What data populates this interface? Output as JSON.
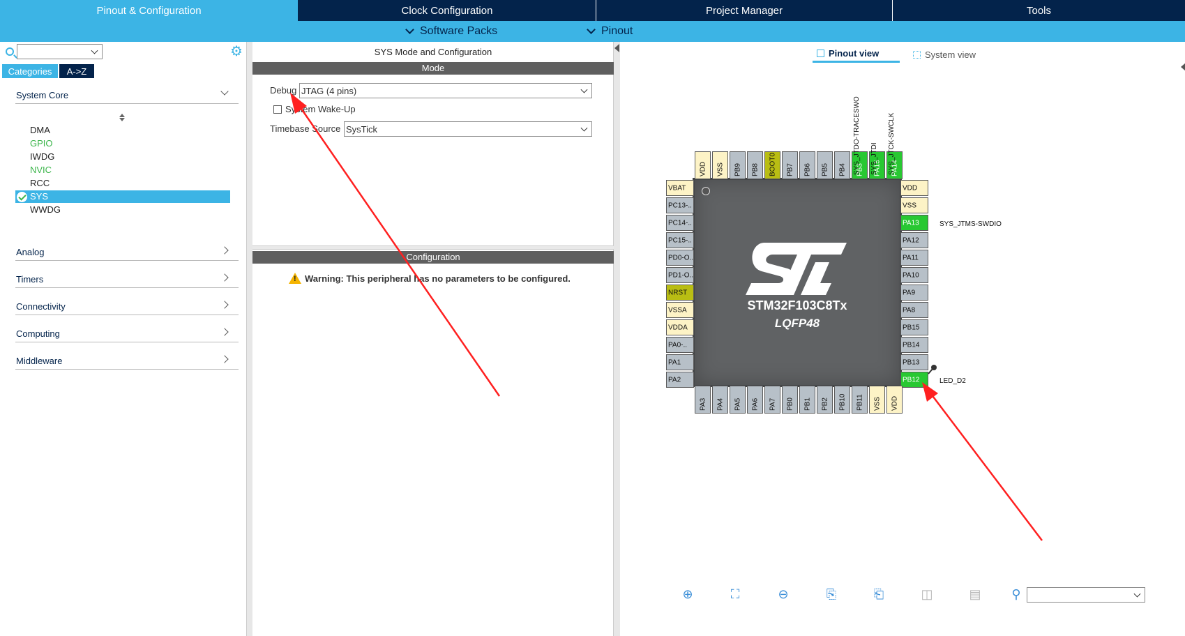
{
  "top_tabs": {
    "pinout": "Pinout & Configuration",
    "clock": "Clock Configuration",
    "project": "Project Manager",
    "tools": "Tools"
  },
  "subbar": {
    "software_packs": "Software Packs",
    "pinout": "Pinout"
  },
  "left": {
    "tabs": {
      "categories": "Categories",
      "az": "A->Z"
    },
    "sections": {
      "system_core": "System Core",
      "analog": "Analog",
      "timers": "Timers",
      "connectivity": "Connectivity",
      "computing": "Computing",
      "middleware": "Middleware"
    },
    "items": {
      "dma": "DMA",
      "gpio": "GPIO",
      "iwdg": "IWDG",
      "nvic": "NVIC",
      "rcc": "RCC",
      "sys": "SYS",
      "wwdg": "WWDG"
    }
  },
  "middle": {
    "title": "SYS Mode and Configuration",
    "mode_header": "Mode",
    "debug_label": "Debug",
    "debug_value": "JTAG (4 pins)",
    "wakeup_label": "System Wake-Up",
    "timebase_label": "Timebase Source",
    "timebase_value": "SysTick",
    "config_header": "Configuration",
    "warning": "Warning: This peripheral has no parameters to be configured."
  },
  "right": {
    "pinout_view": "Pinout view",
    "system_view": "System view",
    "chip_name": "STM32F103C8Tx",
    "chip_package": "LQFP48",
    "pins": {
      "top": [
        "VDD",
        "VSS",
        "PB9",
        "PB8",
        "BOOT0",
        "PB7",
        "PB6",
        "PB5",
        "PB4",
        "PB3",
        "PA15",
        "PA14"
      ],
      "left": [
        "VBAT",
        "PC13-..",
        "PC14-..",
        "PC15-..",
        "PD0-O..",
        "PD1-O..",
        "NRST",
        "VSSA",
        "VDDA",
        "PA0-..",
        "PA1",
        "PA2"
      ],
      "right": [
        "VDD",
        "VSS",
        "PA13",
        "PA12",
        "PA11",
        "PA10",
        "PA9",
        "PA8",
        "PB15",
        "PB14",
        "PB13",
        "PB12"
      ],
      "bottom": [
        "PA3",
        "PA4",
        "PA5",
        "PA6",
        "PA7",
        "PB0",
        "PB1",
        "PB2",
        "PB10",
        "PB11",
        "VSS",
        "VDD"
      ]
    },
    "signal_labels": {
      "pb3": "SYS_JTDO-TRACESWO",
      "pa15": "SYS_JTDI",
      "pa14": "SYS_JTCK-SWCLK",
      "pa13": "SYS_JTMS-SWDIO",
      "pb12": "LED_D2"
    }
  },
  "toolbar": {
    "icons": [
      "zoom-in-icon",
      "fit-icon",
      "zoom-out-icon",
      "export-icon",
      "import-icon",
      "split-icon",
      "layout-icon",
      "search-icon"
    ]
  },
  "colors": {
    "accent": "#3cb4e5",
    "navy": "#03234b",
    "pin_green": "#28c832",
    "pin_olive": "#b9bd13",
    "pin_power": "#fdf3c6",
    "pin_grey": "#b7c0c8",
    "annotation_arrow": "#ff2020"
  }
}
